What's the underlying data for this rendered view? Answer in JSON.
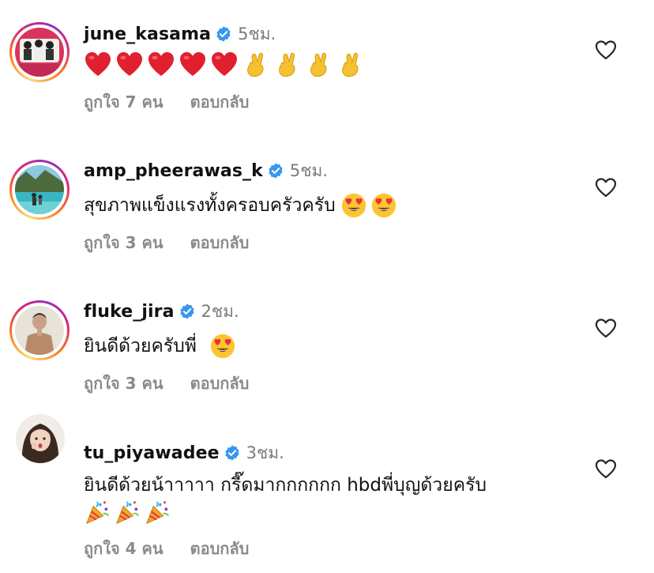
{
  "comments": [
    {
      "username": "june_kasama",
      "time": "5ชม.",
      "text": "",
      "emojis": [
        "red-heart",
        "red-heart",
        "red-heart",
        "red-heart",
        "red-heart",
        "crossed-fingers",
        "crossed-fingers",
        "crossed-fingers",
        "crossed-fingers"
      ],
      "likes": "ถูกใจ 7 คน",
      "reply": "ตอบกลับ"
    },
    {
      "username": "amp_pheerawas_k",
      "time": "5ชม.",
      "text": "สุขภาพแข็งแรงทั้งครอบครัวครับ",
      "emojis": [
        "heart-eyes",
        "heart-eyes"
      ],
      "likes": "ถูกใจ 3 คน",
      "reply": "ตอบกลับ"
    },
    {
      "username": "fluke_jira",
      "time": "2ชม.",
      "text": "ยินดีด้วยครับพี่",
      "emojis": [
        "heart-eyes"
      ],
      "likes": "ถูกใจ 3 คน",
      "reply": "ตอบกลับ"
    },
    {
      "username": "tu_piyawadee",
      "time": "3ชม.",
      "text": "ยินดีด้วยน้าาาาา กรี๊ดมากกกกกก hbdพี่บุญด้วยครับ",
      "emojis": [
        "party-popper",
        "party-popper",
        "party-popper"
      ],
      "likes": "ถูกใจ 4 คน",
      "reply": "ตอบกลับ"
    }
  ],
  "colors": {
    "verified": "#3897f0",
    "meta_text": "#8a8a8a",
    "time_text": "#7a7a7a"
  }
}
